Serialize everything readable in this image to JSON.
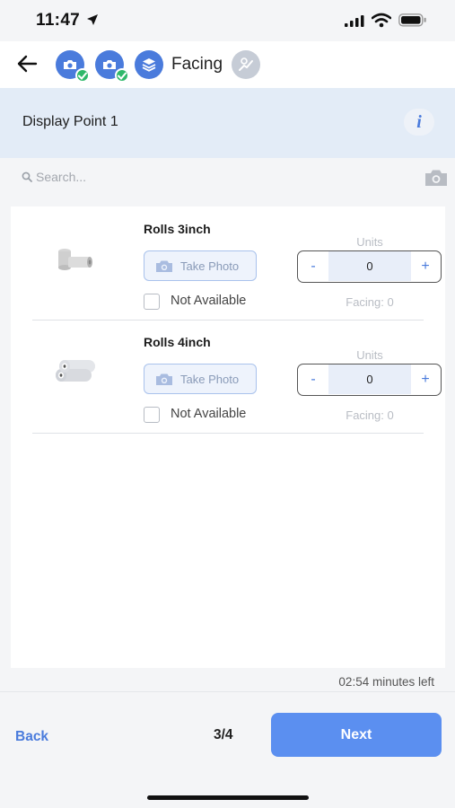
{
  "status_bar": {
    "time": "11:47"
  },
  "header": {
    "current_step_label": "Facing"
  },
  "display_point": {
    "title": "Display Point 1",
    "info_symbol": "i"
  },
  "search": {
    "placeholder": "Search..."
  },
  "products": [
    {
      "name": "Rolls 3inch",
      "take_photo_label": "Take Photo",
      "not_available_label": "Not Available",
      "units_label": "Units",
      "quantity": "0",
      "minus_symbol": "-",
      "plus_symbol": "+",
      "facing_text": "Facing: 0"
    },
    {
      "name": "Rolls 4inch",
      "take_photo_label": "Take Photo",
      "not_available_label": "Not Available",
      "units_label": "Units",
      "quantity": "0",
      "minus_symbol": "-",
      "plus_symbol": "+",
      "facing_text": "Facing: 0"
    }
  ],
  "timer": {
    "text": "02:54 minutes left"
  },
  "footer": {
    "back_label": "Back",
    "page_indicator": "3/4",
    "next_label": "Next"
  },
  "colors": {
    "accent": "#4a7bdc",
    "next_button": "#5b8ff0",
    "check": "#2fb86a",
    "banner": "#e3ecf7"
  },
  "icons": [
    "location-arrow-icon",
    "signal-icon",
    "wifi-icon",
    "battery-icon",
    "back-arrow-icon",
    "camera-icon",
    "layers-icon",
    "chart-icon",
    "check-icon",
    "info-icon",
    "search-icon"
  ]
}
